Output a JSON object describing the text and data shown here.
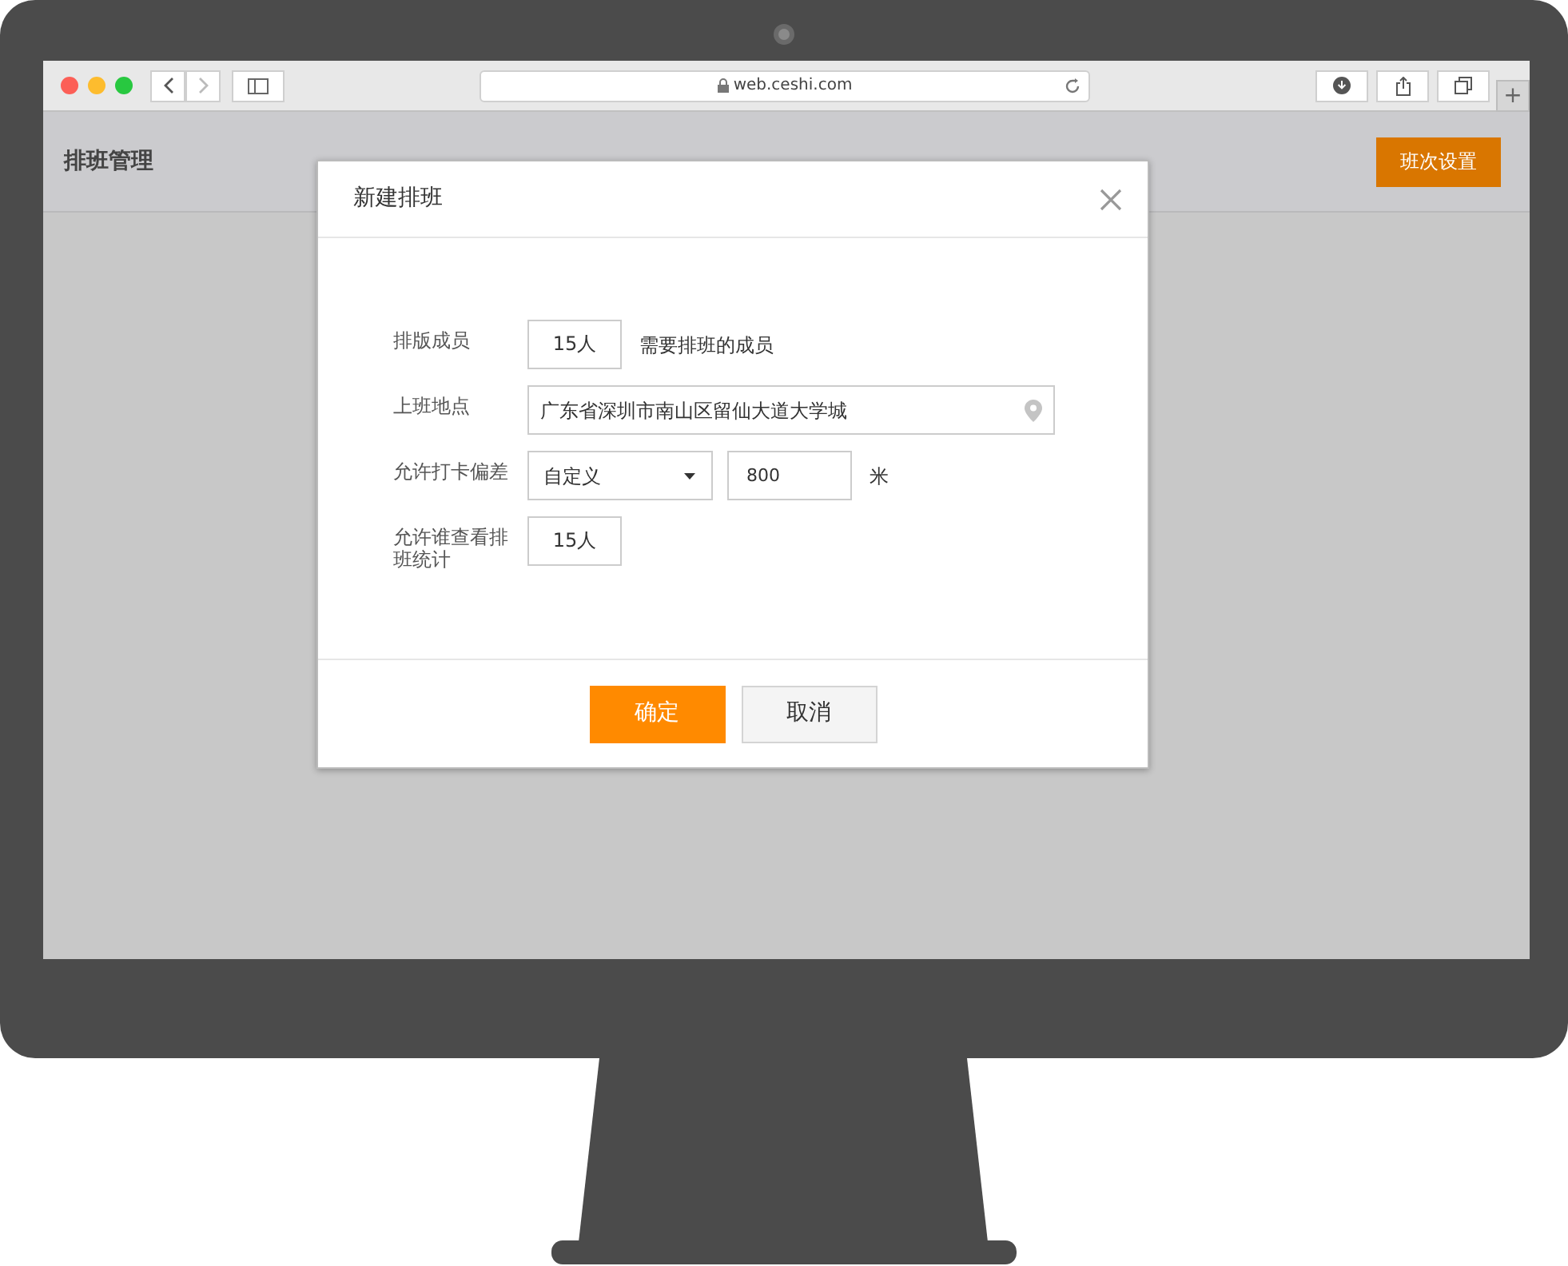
{
  "browser": {
    "nav": [
      {
        "kind": "back",
        "disabled": false
      },
      {
        "kind": "forward",
        "disabled": true
      }
    ],
    "url": "web.ceshi.com",
    "new_tab_button": "+"
  },
  "page": {
    "title": "排班管理",
    "header_button": "班次设置"
  },
  "dialog": {
    "title": "新建排班",
    "fields": [
      {
        "kind": "text",
        "label": "排版成员",
        "value": "15人",
        "hint": "需要排班的成员"
      },
      {
        "kind": "location",
        "label": "上班地点",
        "value": "广东省深圳市南山区留仙大道大学城"
      },
      {
        "kind": "select_number",
        "label": "允许打卡偏差",
        "value": "自定义",
        "number": "800",
        "unit": "米"
      },
      {
        "kind": "text",
        "label": "允许谁查看排班统计",
        "value": "15人"
      }
    ],
    "buttons": [
      {
        "label": "确定",
        "primary": true
      },
      {
        "label": "取消",
        "primary": false
      }
    ]
  }
}
